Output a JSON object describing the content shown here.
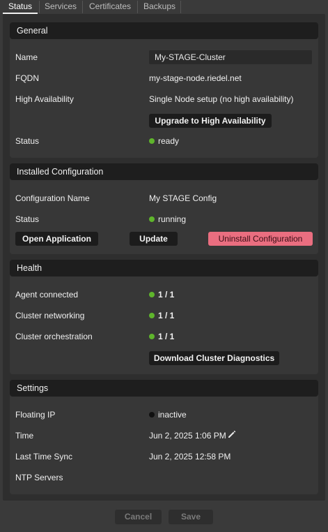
{
  "tabs": [
    "Status",
    "Services",
    "Certificates",
    "Backups"
  ],
  "general": {
    "header": "General",
    "name_label": "Name",
    "name_value": "My-STAGE-Cluster",
    "fqdn_label": "FQDN",
    "fqdn_value": "my-stage-node.riedel.net",
    "ha_label": "High Availability",
    "ha_value": "Single Node setup (no high availability)",
    "upgrade_button": "Upgrade to High Availability",
    "status_label": "Status",
    "status_value": "ready"
  },
  "installed": {
    "header": "Installed Configuration",
    "config_name_label": "Configuration Name",
    "config_name_value": "My STAGE Config",
    "status_label": "Status",
    "status_value": "running",
    "open_button": "Open Application",
    "update_button": "Update",
    "uninstall_button": "Uninstall Configuration"
  },
  "health": {
    "header": "Health",
    "rows": [
      {
        "label": "Agent connected",
        "value": "1 / 1"
      },
      {
        "label": "Cluster networking",
        "value": "1 / 1"
      },
      {
        "label": "Cluster orchestration",
        "value": "1 / 1"
      }
    ],
    "diagnostics_button": "Download Cluster Diagnostics"
  },
  "settings": {
    "header": "Settings",
    "floating_ip_label": "Floating IP",
    "floating_ip_value": "inactive",
    "time_label": "Time",
    "time_value": "Jun 2, 2025 1:06 PM",
    "last_sync_label": "Last Time Sync",
    "last_sync_value": "Jun 2, 2025 12:58 PM",
    "ntp_label": "NTP Servers"
  },
  "footer": {
    "cancel": "Cancel",
    "save": "Save"
  },
  "colors": {
    "ok": "#5fb52c",
    "inactive": "#101010",
    "danger": "#ea6e80"
  }
}
